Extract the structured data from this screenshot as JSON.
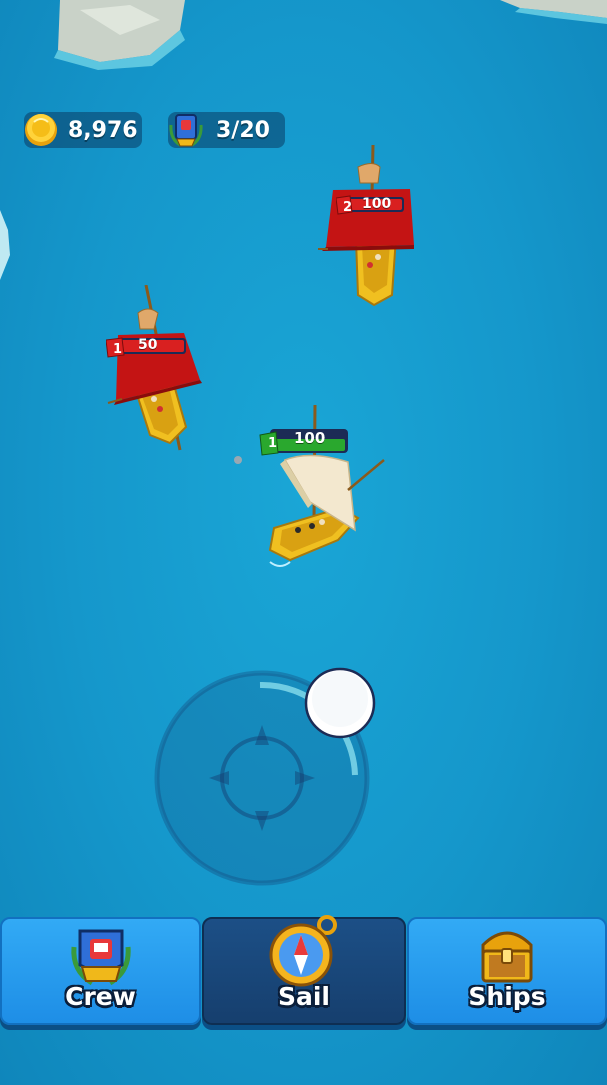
{
  "hud": {
    "gold": "8,976",
    "crew_count": "3/20"
  },
  "ships": {
    "enemy_top": {
      "level": "2",
      "hp": "100"
    },
    "enemy_left": {
      "level": "1",
      "hp": "50"
    },
    "player": {
      "level": "1",
      "hp": "100"
    }
  },
  "nav": {
    "crew_label": "Crew",
    "sail_label": "Sail",
    "ships_label": "Ships",
    "active": "Sail"
  },
  "colors": {
    "sea": "#1597cb",
    "enemy_sail": "#c41414",
    "player_hp": "#2aa82e",
    "enemy_hp": "#d92020",
    "gold": "#f5c016"
  }
}
